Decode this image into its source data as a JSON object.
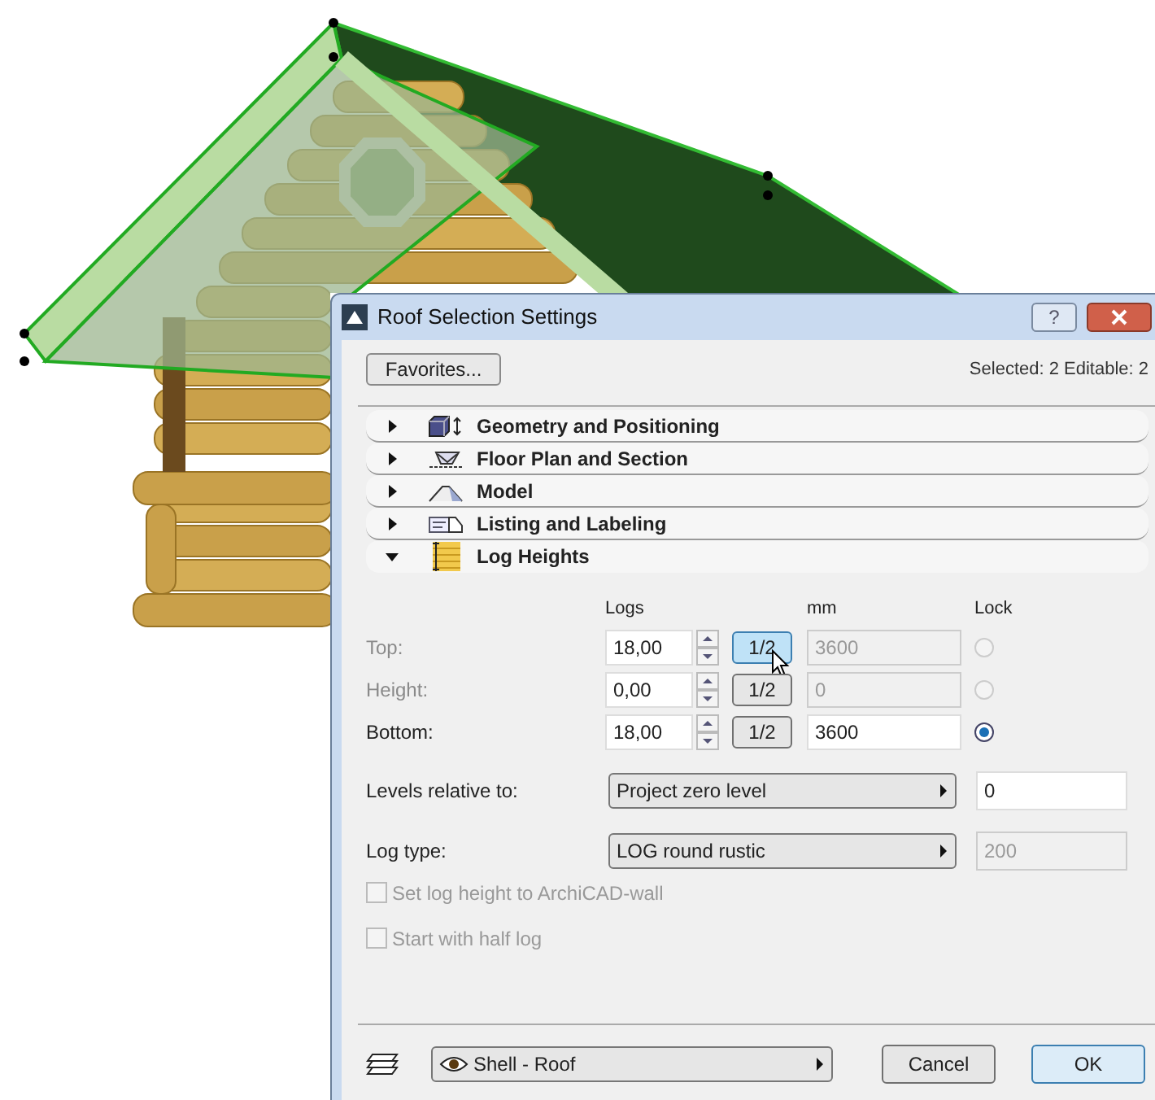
{
  "dialog": {
    "title": "Roof Selection Settings",
    "help_button": "?",
    "favorites_button": "Favorites...",
    "selection_info": "Selected: 2 Editable: 2",
    "panels": [
      {
        "label": "Geometry and Positioning",
        "expanded": false,
        "kind": "geometry"
      },
      {
        "label": "Floor Plan and Section",
        "expanded": false,
        "kind": "floor-plan"
      },
      {
        "label": "Model",
        "expanded": false,
        "kind": "model"
      },
      {
        "label": "Listing and Labeling",
        "expanded": false,
        "kind": "listing"
      },
      {
        "label": "Log Heights",
        "expanded": true,
        "kind": "log-heights"
      }
    ],
    "columns": [
      "Logs",
      "mm",
      "Lock"
    ],
    "height_rows": [
      {
        "label": "Top:",
        "disabled": true,
        "logs": "18,00",
        "half_button": "1/2",
        "hovered": true,
        "mm": "3600",
        "locked": false
      },
      {
        "label": "Height:",
        "disabled": true,
        "logs": "0,00",
        "half_button": "1/2",
        "hovered": false,
        "mm": "0",
        "locked": false
      },
      {
        "label": "Bottom:",
        "disabled": false,
        "logs": "18,00",
        "half_button": "1/2",
        "hovered": false,
        "mm": "3600",
        "locked": true
      }
    ],
    "selects": [
      {
        "label": "Levels relative to:",
        "value": "Project zero level",
        "field": "0",
        "field_disabled": false
      },
      {
        "label": "Log type:",
        "value": "LOG round rustic",
        "field": "200",
        "field_disabled": true
      }
    ],
    "checkboxes": [
      {
        "label": "Set log height to ArchiCAD-wall",
        "checked": false,
        "disabled": true
      },
      {
        "label": "Start with half log",
        "checked": false,
        "disabled": true
      }
    ],
    "layer": "Shell - Roof",
    "buttons": [
      {
        "label": "Cancel",
        "default": false
      },
      {
        "label": "OK",
        "default": true
      }
    ]
  }
}
